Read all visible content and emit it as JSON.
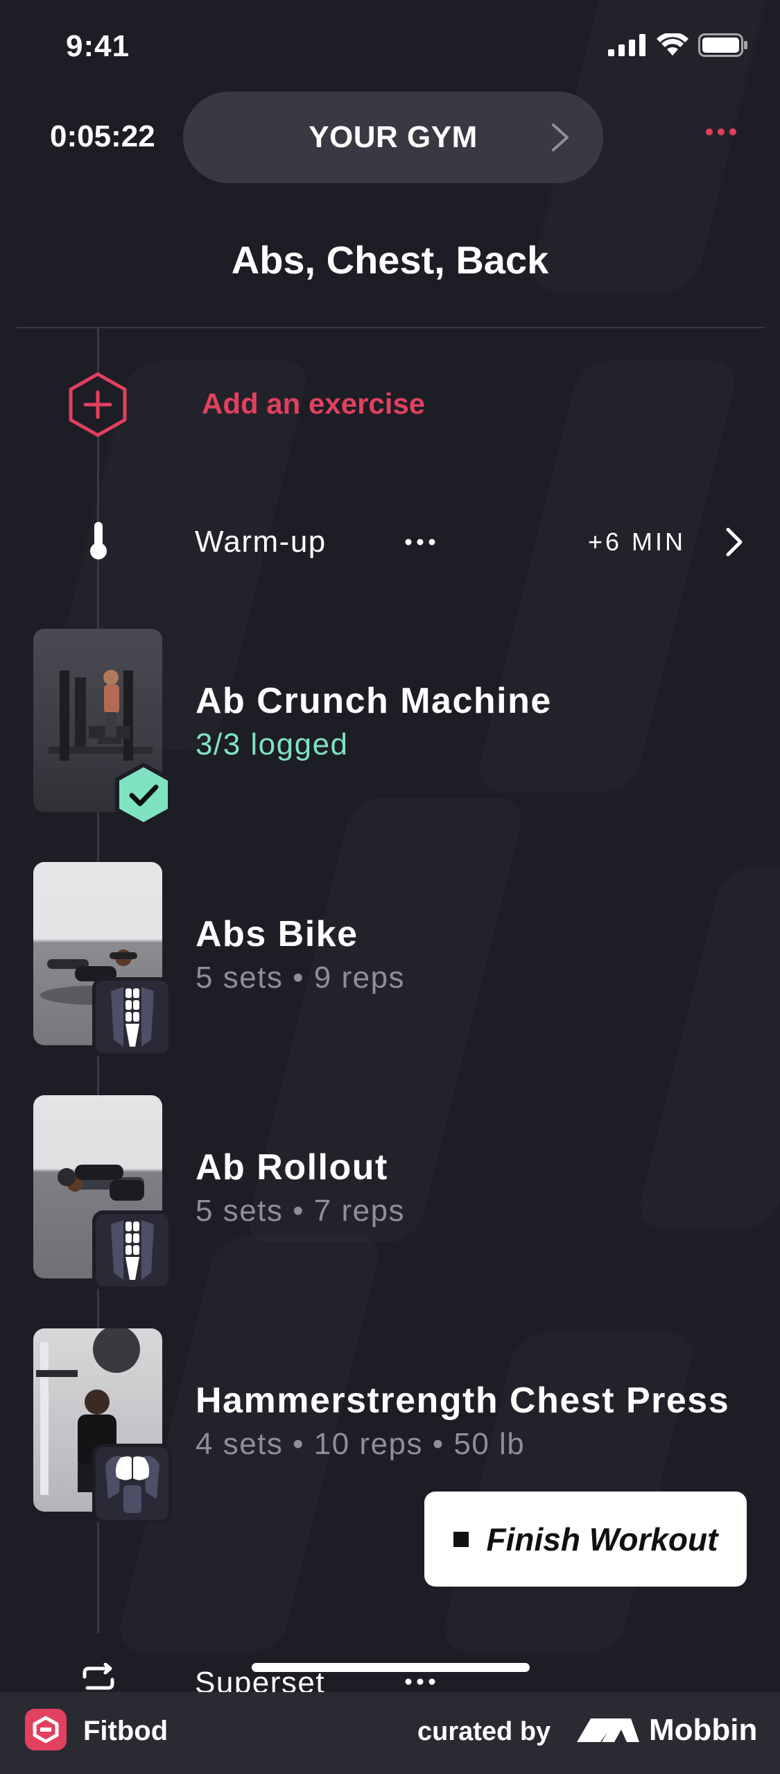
{
  "status_bar": {
    "time": "9:41",
    "icons": [
      "signal-icon",
      "wifi-icon",
      "battery-icon"
    ]
  },
  "header": {
    "timer": "0:05:22",
    "gym_label": "YOUR GYM",
    "title": "Abs, Chest, Back"
  },
  "add_exercise": {
    "label": "Add an exercise"
  },
  "warmup": {
    "label": "Warm-up",
    "duration": "+6 MIN"
  },
  "exercises": [
    {
      "name": "Ab Crunch Machine",
      "detail": "3/3 logged",
      "completed": true
    },
    {
      "name": "Abs Bike",
      "detail": "5 sets • 9 reps",
      "muscle_icon": "abs-muscle-icon"
    },
    {
      "name": "Ab Rollout",
      "detail": "5 sets • 7 reps",
      "muscle_icon": "abs-muscle-icon"
    },
    {
      "name": "Hammerstrength Chest Press",
      "detail": "4 sets • 10 reps • 50 lb",
      "muscle_icon": "chest-muscle-icon"
    }
  ],
  "finish_button": {
    "label": "Finish Workout"
  },
  "superset": {
    "label": "Superset"
  },
  "footer": {
    "app_name": "Fitbod",
    "curated_by": "curated by",
    "brand": "Mobbin"
  },
  "colors": {
    "accent": "#e2405f",
    "logged": "#7fe3c2",
    "background": "#1d1d25"
  }
}
